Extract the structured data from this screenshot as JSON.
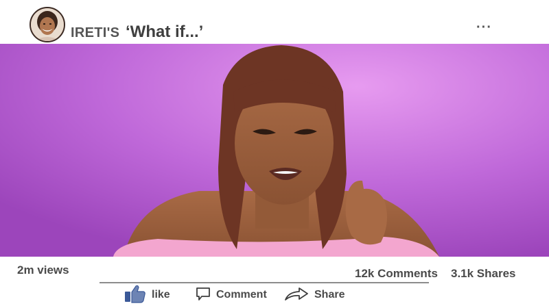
{
  "post": {
    "author": "IRETI'S",
    "title": "‘What if...’",
    "more_label": "···"
  },
  "stats": {
    "views": "2m views",
    "comments": "12k Comments",
    "shares": "3.1k Shares"
  },
  "actions": {
    "like": "like",
    "comment": "Comment",
    "share": "Share"
  },
  "colors": {
    "background": "#ffffff",
    "text": "#4a4a4a",
    "like_blue": "#3b5998",
    "media_purple": "#b25fd2"
  }
}
